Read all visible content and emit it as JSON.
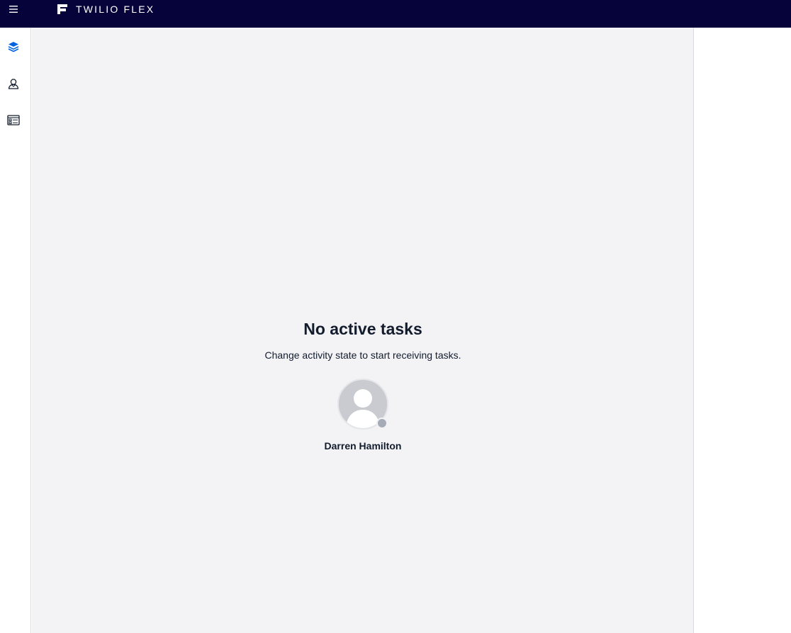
{
  "header": {
    "brand": "TWILIO FLEX",
    "menu_icon": "hamburger-icon",
    "background": "#06033a"
  },
  "sidebar": {
    "items": [
      {
        "id": "tasks",
        "icon": "layers-icon",
        "active": true,
        "color": "#0263e0"
      },
      {
        "id": "teams",
        "icon": "agent-icon",
        "active": false,
        "color": "#121c2d"
      },
      {
        "id": "queues",
        "icon": "queue-dashboard-icon",
        "active": false,
        "color": "#121c2d"
      }
    ]
  },
  "main": {
    "empty_title": "No active tasks",
    "empty_subtitle": "Change activity state to start receiving tasks.",
    "agent": {
      "name": "Darren Hamilton",
      "status_color": "#a6acb7"
    }
  }
}
